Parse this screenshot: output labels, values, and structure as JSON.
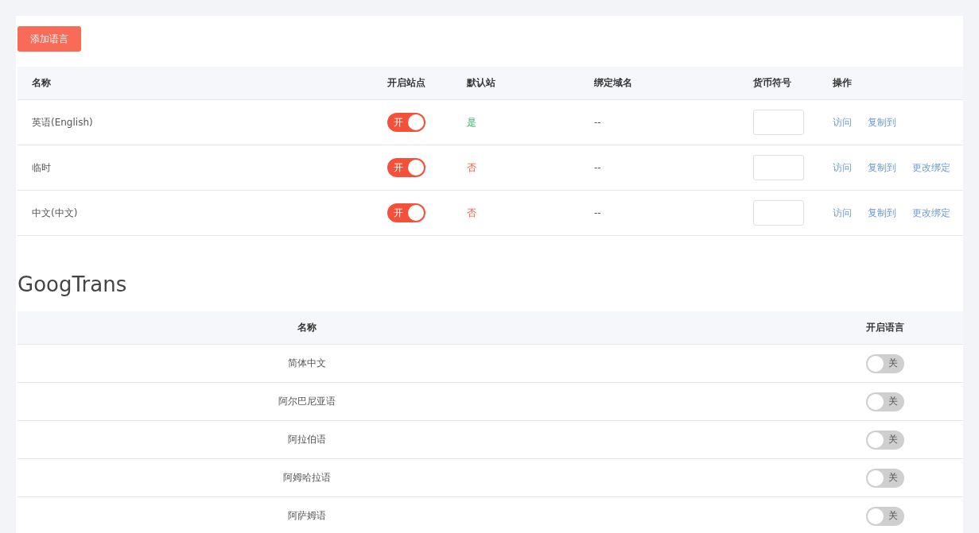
{
  "add_button": "添加语言",
  "sites_table": {
    "columns": [
      "名称",
      "开启站点",
      "默认站",
      "绑定域名",
      "货币符号",
      "操作"
    ],
    "rows": [
      {
        "name": "英语(English)",
        "toggle": {
          "label": "开",
          "on": true
        },
        "default_site": {
          "text": "是",
          "selected": true
        },
        "domain": "--",
        "currency": "",
        "actions": [
          "访问",
          "复制到"
        ]
      },
      {
        "name": "临时",
        "toggle": {
          "label": "开",
          "on": true
        },
        "default_site": {
          "text": "否",
          "selected": false
        },
        "domain": "--",
        "currency": "",
        "actions": [
          "访问",
          "复制到",
          "更改绑定"
        ]
      },
      {
        "name": "中文(中文)",
        "toggle": {
          "label": "开",
          "on": true
        },
        "default_site": {
          "text": "否",
          "selected": false
        },
        "domain": "--",
        "currency": "",
        "actions": [
          "访问",
          "复制到",
          "更改绑定"
        ]
      }
    ]
  },
  "section_title": "GoogTrans",
  "googtrans_table": {
    "columns": [
      "名称",
      "开启语言"
    ],
    "rows": [
      {
        "name": "简体中文",
        "toggle": {
          "label": "关",
          "on": false
        }
      },
      {
        "name": "阿尔巴尼亚语",
        "toggle": {
          "label": "关",
          "on": false
        }
      },
      {
        "name": "阿拉伯语",
        "toggle": {
          "label": "关",
          "on": false
        }
      },
      {
        "name": "阿姆哈拉语",
        "toggle": {
          "label": "关",
          "on": false
        }
      },
      {
        "name": "阿萨姆语",
        "toggle": {
          "label": "关",
          "on": false
        }
      }
    ]
  }
}
